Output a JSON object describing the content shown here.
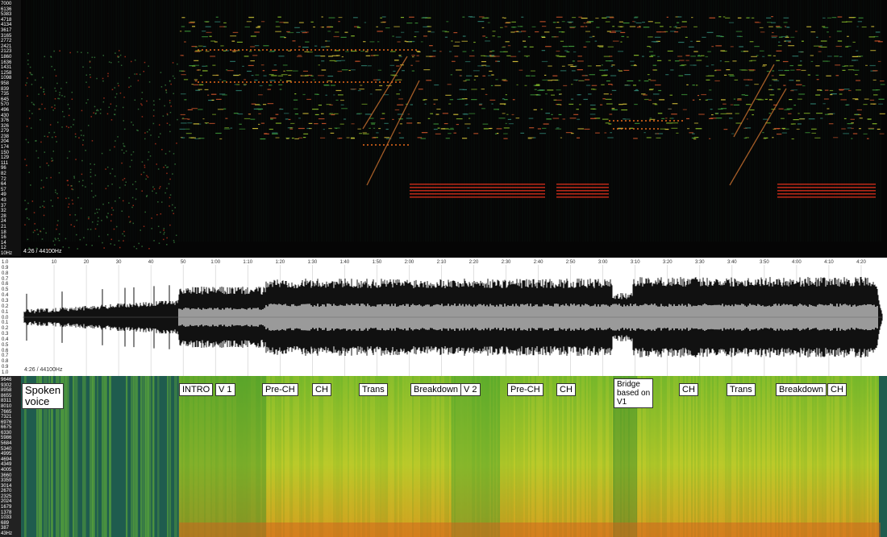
{
  "spectrogram": {
    "frequency_labels": [
      "7000",
      "6136",
      "5383",
      "4718",
      "4134",
      "3617",
      "3165",
      "2772",
      "2421",
      "2123",
      "1860",
      "1636",
      "1431",
      "1258",
      "1098",
      "958",
      "839",
      "735",
      "645",
      "570",
      "496",
      "430",
      "376",
      "326",
      "279",
      "238",
      "204",
      "174",
      "150",
      "129",
      "111",
      "96",
      "82",
      "72",
      "64",
      "57",
      "49",
      "43",
      "37",
      "32",
      "28",
      "24",
      "21",
      "18",
      "16",
      "14",
      "12",
      "10Hz"
    ],
    "caption": "4:26 / 44100Hz"
  },
  "waveform": {
    "amplitude_labels": [
      "1.0",
      "0.9",
      "0.8",
      "0.7",
      "0.6",
      "0.5",
      "0.4",
      "0.3",
      "0.2",
      "0.1",
      "0.0",
      "0.1",
      "0.2",
      "0.3",
      "0.4",
      "0.5",
      "0.6",
      "0.7",
      "0.8",
      "0.9",
      "1.0"
    ],
    "time_ticks": [
      "10",
      "20",
      "30",
      "40",
      "50",
      "1:00",
      "1:10",
      "1:20",
      "1:30",
      "1:40",
      "1:50",
      "2:00",
      "2:10",
      "2:20",
      "2:30",
      "2:40",
      "2:50",
      "3:00",
      "3:10",
      "3:20",
      "3:30",
      "3:40",
      "3:50",
      "4:00",
      "4:10",
      "4:20"
    ],
    "caption": "4:26 / 44100Hz"
  },
  "frequency_map": {
    "frequency_labels": [
      "9646",
      "9302",
      "8958",
      "8655",
      "8311",
      "8010",
      "7665",
      "7321",
      "6976",
      "6675",
      "6330",
      "5986",
      "5684",
      "5340",
      "4995",
      "4694",
      "4349",
      "4005",
      "3660",
      "3359",
      "3014",
      "2670",
      "2325",
      "2024",
      "1679",
      "1378",
      "1033",
      "689",
      "387",
      "43Hz"
    ]
  },
  "sections": [
    {
      "label": "Spoken\nvoice"
    },
    {
      "label": "INTRO"
    },
    {
      "label": "V 1"
    },
    {
      "label": "Pre-CH"
    },
    {
      "label": "CH"
    },
    {
      "label": "Trans"
    },
    {
      "label": "Breakdown"
    },
    {
      "label": "V 2"
    },
    {
      "label": "Pre-CH"
    },
    {
      "label": "CH"
    },
    {
      "label": "Bridge\nbased on\nV1"
    },
    {
      "label": "CH"
    },
    {
      "label": "Trans"
    },
    {
      "label": "Breakdown"
    },
    {
      "label": "CH"
    }
  ]
}
